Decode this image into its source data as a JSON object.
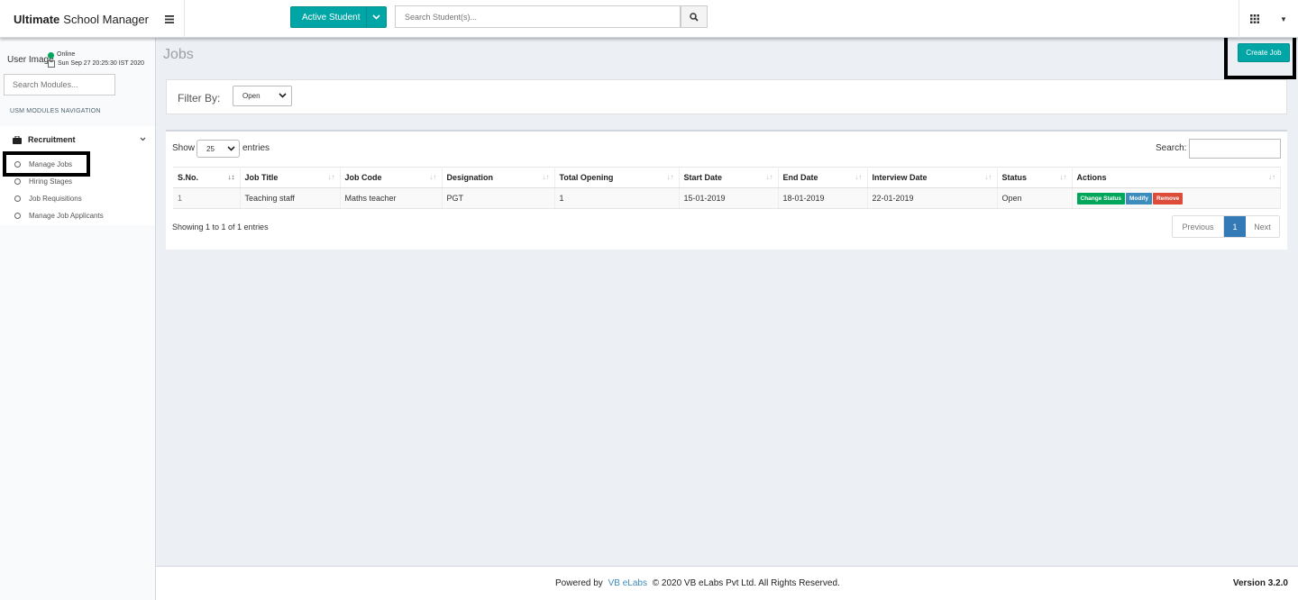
{
  "header": {
    "brand_bold": "Ultimate",
    "brand_rest": "School Manager",
    "active_student_label": "Active Student",
    "search_placeholder": "Search Student(s)..."
  },
  "sidebar": {
    "user_image_alt": "User Image",
    "status": "Online",
    "datetime": "Sun Sep 27 20:25:30 IST 2020",
    "module_search_placeholder": "Search Modules...",
    "nav_header": "USM MODULES NAVIGATION",
    "section": "Recruitment",
    "items": [
      {
        "label": "Manage Jobs"
      },
      {
        "label": "Hiring Stages"
      },
      {
        "label": "Job Requisitions"
      },
      {
        "label": "Manage Job Applicants"
      }
    ]
  },
  "main": {
    "title": "Jobs",
    "create_button": "Create Job",
    "filter_label": "Filter By:",
    "filter_value": "Open",
    "show_label": "Show",
    "show_value": "25",
    "entries_label": "entries",
    "search_label": "Search:",
    "columns": [
      "S.No.",
      "Job Title",
      "Job Code",
      "Designation",
      "Total Opening",
      "Start Date",
      "End Date",
      "Interview Date",
      "Status",
      "Actions"
    ],
    "rows": [
      {
        "sno": "1",
        "job_title": "Teaching staff",
        "job_code": "Maths teacher",
        "designation": "PGT",
        "total_opening": "1",
        "start_date": "15-01-2019",
        "end_date": "18-01-2019",
        "interview_date": "22-01-2019",
        "status": "Open",
        "actions": [
          "Change Status",
          "Modify",
          "Remove"
        ]
      }
    ],
    "info": "Showing 1 to 1 of 1 entries",
    "pager": {
      "prev": "Previous",
      "page": "1",
      "next": "Next"
    }
  },
  "footer": {
    "powered_by": "Powered by",
    "company_link": "VB eLabs",
    "copyright": "© 2020 VB eLabs Pvt Ltd. All Rights Reserved.",
    "version": "Version 3.2.0"
  },
  "colors": {
    "accent": "#00a6a6",
    "success": "#00a65a",
    "info": "#3c8dbc",
    "danger": "#dd4b39",
    "pager_active": "#337ab7"
  },
  "icons": [
    "hamburger-icon",
    "chevron-down-icon",
    "search-icon",
    "apps-grid-icon",
    "caret-down-icon",
    "calendar-icon",
    "briefcase-icon",
    "circle-icon",
    "sort-icon"
  ]
}
